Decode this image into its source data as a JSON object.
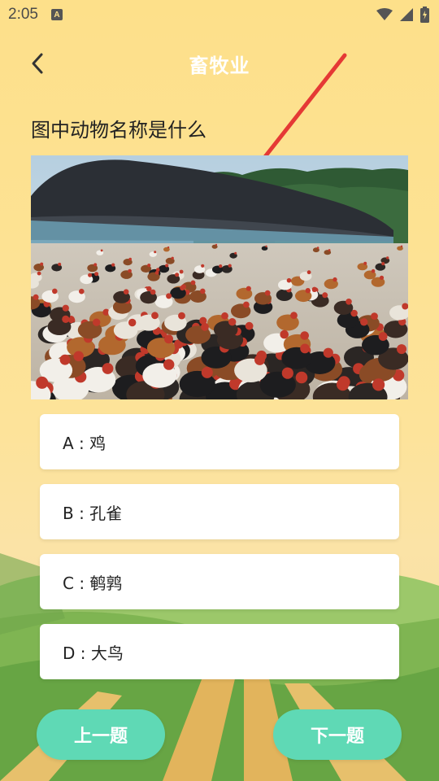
{
  "status_bar": {
    "time": "2:05",
    "notification_letter": "A"
  },
  "header": {
    "title": "畜牧业"
  },
  "question": {
    "text": "图中动物名称是什么"
  },
  "options": [
    {
      "label": "A : 鸡"
    },
    {
      "label": "B : 孔雀"
    },
    {
      "label": "C : 鹌鹑"
    },
    {
      "label": "D : 大鸟"
    }
  ],
  "nav": {
    "prev_label": "上一题",
    "next_label": "下一题"
  },
  "colors": {
    "accent": "#5fd9b5",
    "background": "#fde08a",
    "arrow": "#e53935"
  }
}
